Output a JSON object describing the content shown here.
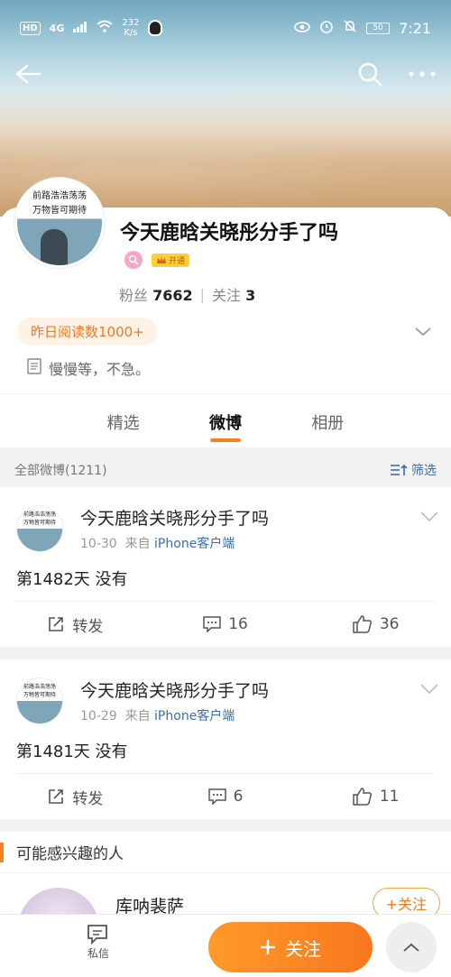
{
  "status_bar": {
    "hd": "HD",
    "net": "4G",
    "speed_value": "232",
    "speed_unit": "K/s",
    "battery": "50",
    "time": "7:21"
  },
  "profile": {
    "avatar_line1": "前路浩浩荡荡",
    "avatar_line2": "万物皆可期待",
    "name": "今天鹿晗关晓彤分手了吗",
    "vip_label": "开通",
    "fans_label": "粉丝",
    "fans_count": "7662",
    "follow_label": "关注",
    "follow_count": "3",
    "read_tag": "昨日阅读数1000+",
    "bio": "慢慢等，不急。"
  },
  "tabs": [
    {
      "label": "精选"
    },
    {
      "label": "微博"
    },
    {
      "label": "相册"
    }
  ],
  "filter": {
    "all_label": "全部微博(1211)",
    "filter_label": "筛选"
  },
  "posts": [
    {
      "author": "今天鹿晗关晓彤分手了吗",
      "date": "10-30",
      "from": "来自",
      "source": "iPhone客户端",
      "text": "第1482天 没有",
      "repost": "转发",
      "comments": "16",
      "likes": "36"
    },
    {
      "author": "今天鹿晗关晓彤分手了吗",
      "date": "10-29",
      "from": "来自",
      "source": "iPhone客户端",
      "text": "第1481天 没有",
      "repost": "转发",
      "comments": "6",
      "likes": "11"
    }
  ],
  "interest": {
    "title": "可能感兴趣的人",
    "rec_name": "库呐裴萨",
    "follow_label": "+关注"
  },
  "bottom": {
    "dm_label": "私信",
    "follow_label": "关注"
  },
  "colors": {
    "accent": "#f78122",
    "link": "#3c6ea8"
  }
}
